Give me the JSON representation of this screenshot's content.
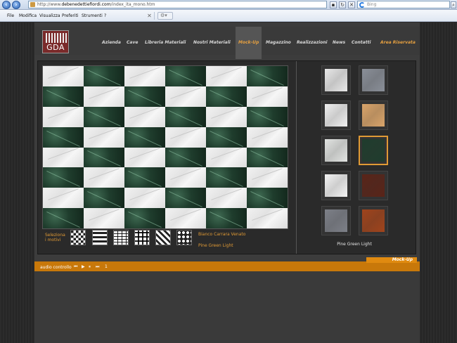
{
  "browser": {
    "url_prefix": "http://www.",
    "url_domain": "debenedettiefiordi.com",
    "url_path": "/index_ita_mono.htm",
    "search_placeholder": "Bing",
    "menu": [
      "File",
      "Modifica",
      "Visualizza",
      "Preferiti",
      "Strumenti",
      "?"
    ]
  },
  "site": {
    "logo_text": "GDA",
    "nav": [
      "Azienda",
      "Cave",
      "Libreria Materiali",
      "Nostri Materiali",
      "Mock-Up",
      "Magazzino",
      "Realizzazioni",
      "News",
      "Contatti",
      "Area Riservata"
    ],
    "active_nav": "Mock-Up",
    "motif_label": "Seleziona i motivi",
    "selected_material_1": "Bianco Carrara Venato",
    "selected_material_2": "Pine Green Light",
    "swatch_caption": "Pine Green Light",
    "section_tab": "Mock-Up",
    "audio_label": "audio controllo",
    "audio_buttons": [
      "⏮",
      "▶",
      "⏸",
      "⏭",
      "1"
    ]
  },
  "colors": {
    "accent": "#e09a35",
    "strip": "#c8780a"
  },
  "swatches": [
    {
      "name": "bianco-carrara",
      "color": "#e8e8e8"
    },
    {
      "name": "grey-bardiglio",
      "color": "#8a8f98"
    },
    {
      "name": "white-statuario",
      "color": "#f0f0f0"
    },
    {
      "name": "beige-marble",
      "color": "#d9a46a"
    },
    {
      "name": "white-venato",
      "color": "#e2e4e2"
    },
    {
      "name": "pine-green-light",
      "color": "#1f3d2d"
    },
    {
      "name": "white-thassos",
      "color": "#f4f4f4"
    },
    {
      "name": "rosso-levanto",
      "color": "#5a2418"
    },
    {
      "name": "grey-dark",
      "color": "#7d8088"
    },
    {
      "name": "red-alicante",
      "color": "#a0441c"
    }
  ],
  "pattern": [
    "white",
    "green",
    "white",
    "green",
    "white",
    "green"
  ]
}
